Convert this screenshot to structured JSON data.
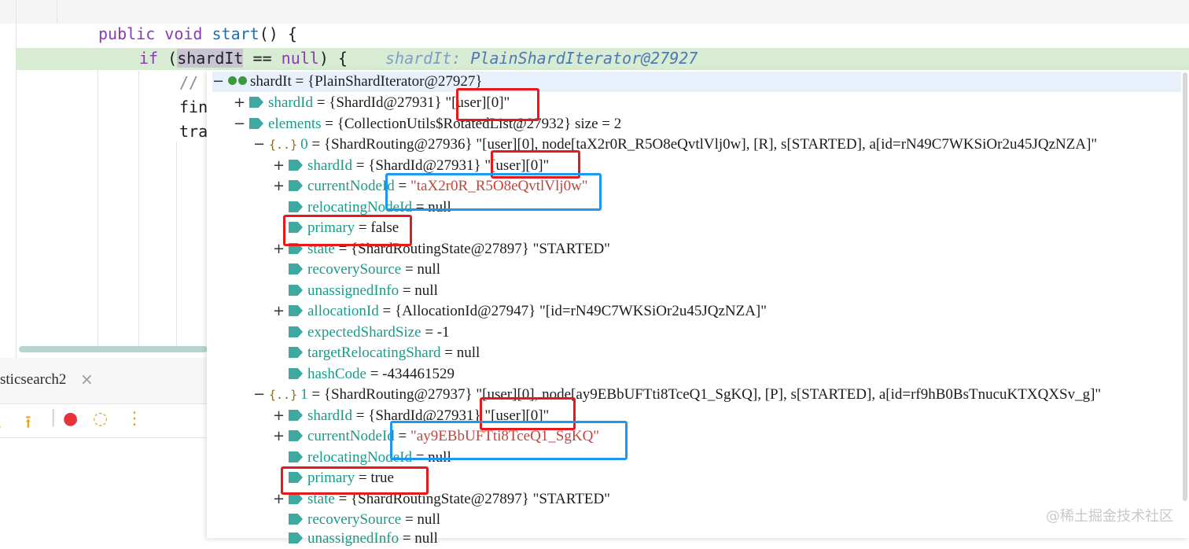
{
  "editor": {
    "lines": [
      {
        "tokens": [
          "public",
          " ",
          "void",
          " ",
          "start",
          "() {"
        ]
      },
      {
        "tokens": [
          "if",
          " (",
          "shardIt",
          " == ",
          "null",
          ") {"
        ],
        "hint_key": "shardIt:",
        "hint_value": "PlainShardIterator@27927"
      },
      {
        "text": "//"
      },
      {
        "text": "fin"
      },
      {
        "text": "tra"
      }
    ]
  },
  "panel": {
    "tab_label": "sticsearch2",
    "tab_close": "×",
    "tools": [
      "⭳",
      "⭱",
      "|",
      "●",
      "◌",
      "⋮"
    ]
  },
  "popup": {
    "rows": [
      {
        "expander": "−",
        "icon": "glasses-icon",
        "name": "shardIt",
        "rest": " = {PlainShardIterator@27927}"
      },
      {
        "expander": "+",
        "icon": "tag-icon",
        "name": "shardId",
        "rest": " = {ShardId@27931} \"[user][0]\""
      },
      {
        "expander": "−",
        "icon": "tag-icon",
        "name": "elements",
        "rest": " = {CollectionUtils$RotatedList@27932}  size = 2"
      },
      {
        "expander": "−",
        "icon": "brace-icon",
        "name": "0",
        "rest": " = {ShardRouting@27936} \"[user][0], node[taX2r0R_R5O8eQvtlVlj0w], [R], s[STARTED], a[id=rN49C7WKSiOr2u45JQzNZA]\""
      },
      {
        "expander": "+",
        "icon": "tag-icon",
        "name": "shardId",
        "rest": " = {ShardId@27931} \"[user][0]\""
      },
      {
        "expander": "+",
        "icon": "tag-icon",
        "name": "currentNodeId",
        "rest": " = ",
        "str": "\"taX2r0R_R5O8eQvtlVlj0w\""
      },
      {
        "expander": "",
        "icon": "tag-icon",
        "name": "relocatingNodeId",
        "rest": " = null"
      },
      {
        "expander": "",
        "icon": "tag-icon",
        "name": "primary",
        "rest": " = false"
      },
      {
        "expander": "+",
        "icon": "tag-icon",
        "name": "state",
        "rest": " = {ShardRoutingState@27897} \"STARTED\""
      },
      {
        "expander": "",
        "icon": "tag-icon",
        "name": "recoverySource",
        "rest": " = null"
      },
      {
        "expander": "",
        "icon": "tag-icon",
        "name": "unassignedInfo",
        "rest": " = null"
      },
      {
        "expander": "+",
        "icon": "tag-icon",
        "name": "allocationId",
        "rest": " = {AllocationId@27947} \"[id=rN49C7WKSiOr2u45JQzNZA]\""
      },
      {
        "expander": "",
        "icon": "tag-icon",
        "name": "expectedShardSize",
        "rest": " = -1"
      },
      {
        "expander": "",
        "icon": "tag-icon",
        "name": "targetRelocatingShard",
        "rest": " = null"
      },
      {
        "expander": "",
        "icon": "tag-icon",
        "name": "hashCode",
        "rest": " = -434461529"
      },
      {
        "expander": "−",
        "icon": "brace-icon",
        "name": "1",
        "rest": " = {ShardRouting@27937} \"[user][0], node[ay9EBbUFTti8TceQ1_SgKQ], [P], s[STARTED], a[id=rf9hB0BsTnucuKTXQXSv_g]\""
      },
      {
        "expander": "+",
        "icon": "tag-icon",
        "name": "shardId",
        "rest": " = {ShardId@27931} \"[user][0]\""
      },
      {
        "expander": "+",
        "icon": "tag-icon",
        "name": "currentNodeId",
        "rest": " = ",
        "str": "\"ay9EBbUFTti8TceQ1_SgKQ\""
      },
      {
        "expander": "",
        "icon": "tag-icon",
        "name": "relocatingNodeId",
        "rest": " = null"
      },
      {
        "expander": "",
        "icon": "tag-icon",
        "name": "primary",
        "rest": " = true"
      },
      {
        "expander": "+",
        "icon": "tag-icon",
        "name": "state",
        "rest": " = {ShardRoutingState@27897} \"STARTED\""
      },
      {
        "expander": "",
        "icon": "tag-icon",
        "name": "recoverySource",
        "rest": " = null"
      },
      {
        "expander": "",
        "icon": "tag-icon",
        "name": "unassignedInfo",
        "rest": " = null"
      }
    ]
  },
  "watermark": "@稀土掘金技术社区",
  "colors": {
    "annotation_red": "#e8191b",
    "annotation_blue": "#1e97f0",
    "field_name": "#179b8a",
    "string": "#c2453d"
  }
}
